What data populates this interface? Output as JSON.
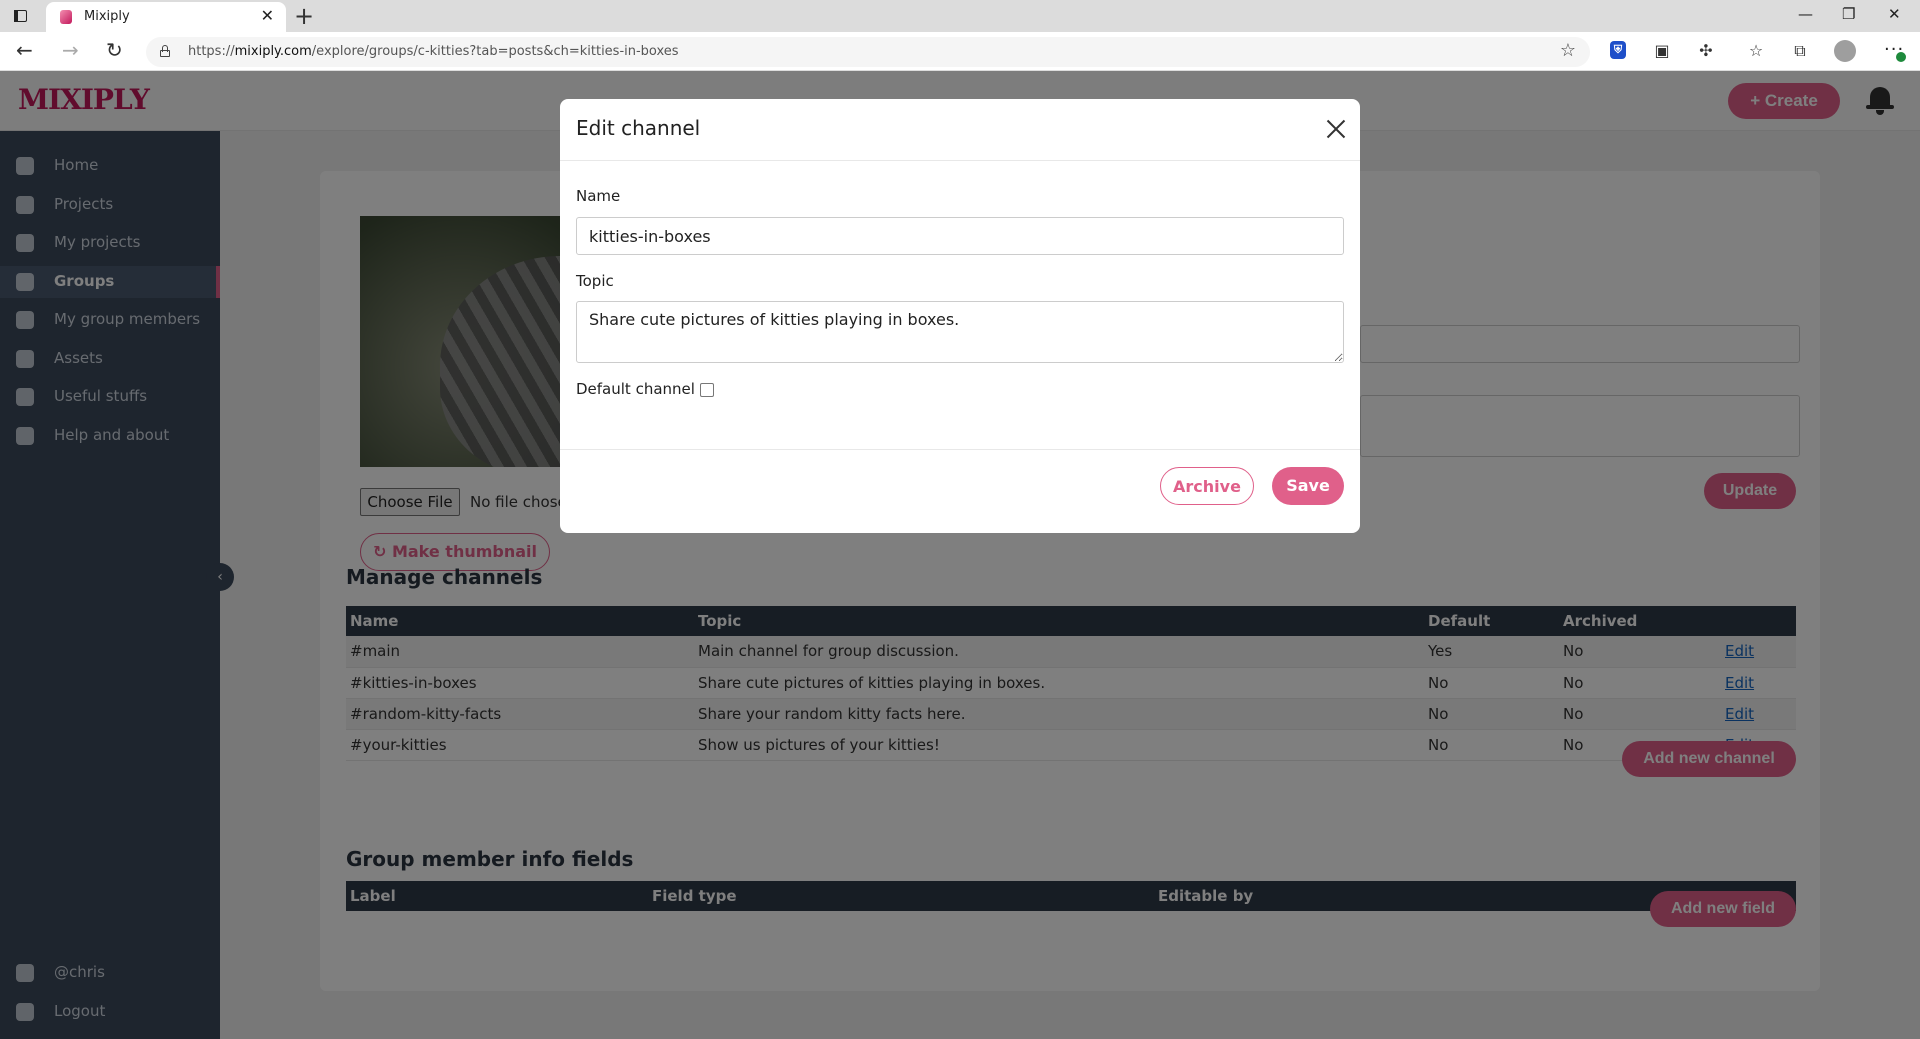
{
  "browser": {
    "tab_title": "Mixiply",
    "url_prefix": "https://",
    "url_domain": "mixiply.com",
    "url_path": "/explore/groups/c-kitties?tab=posts&ch=kitties-in-boxes"
  },
  "app": {
    "logo_text": "MIXIPLY",
    "create_label": "+ Create"
  },
  "sidebar": {
    "items": [
      {
        "label": "Home",
        "icon": "home-icon"
      },
      {
        "label": "Projects",
        "icon": "heart-icon"
      },
      {
        "label": "My projects",
        "icon": "brush-icon"
      },
      {
        "label": "Groups",
        "icon": "users-icon"
      },
      {
        "label": "My group members",
        "icon": "group-icon"
      },
      {
        "label": "Assets",
        "icon": "cloud-icon"
      },
      {
        "label": "Useful stuffs",
        "icon": "lightbulb-icon"
      },
      {
        "label": "Help and about",
        "icon": "question-icon"
      }
    ],
    "bottom": [
      {
        "label": "@chris",
        "icon": "user-icon"
      },
      {
        "label": "Logout",
        "icon": "logout-icon"
      }
    ]
  },
  "group_settings": {
    "choose_file_label": "Choose File",
    "file_note": "No file chose",
    "make_thumbnail_label": "Make thumbnail",
    "update_label": "Update"
  },
  "channels": {
    "title": "Manage channels",
    "headers": [
      "Name",
      "Topic",
      "Default",
      "Archived",
      ""
    ],
    "rows": [
      {
        "name": "#main",
        "topic": "Main channel for group discussion.",
        "default": "Yes",
        "archived": "No",
        "edit": "Edit"
      },
      {
        "name": "#kitties-in-boxes",
        "topic": "Share cute pictures of kitties playing in boxes.",
        "default": "No",
        "archived": "No",
        "edit": "Edit"
      },
      {
        "name": "#random-kitty-facts",
        "topic": "Share your random kitty facts here.",
        "default": "No",
        "archived": "No",
        "edit": "Edit"
      },
      {
        "name": "#your-kitties",
        "topic": "Show us pictures of your kitties!",
        "default": "No",
        "archived": "No",
        "edit": "Edit"
      }
    ],
    "add_label": "Add new channel"
  },
  "member_fields": {
    "title": "Group member info fields",
    "headers": [
      "Label",
      "Field type",
      "Editable by"
    ],
    "add_label": "Add new field"
  },
  "modal": {
    "title": "Edit channel",
    "name_label": "Name",
    "name_value": "kitties-in-boxes",
    "topic_label": "Topic",
    "topic_value": "Share cute pictures of kitties playing in boxes.",
    "default_label": "Default channel",
    "default_checked": false,
    "archive_label": "Archive",
    "save_label": "Save"
  },
  "colors": {
    "accent": "#e0608a",
    "sidebar": "#3d4a5c",
    "table_header": "#2f3a48"
  }
}
